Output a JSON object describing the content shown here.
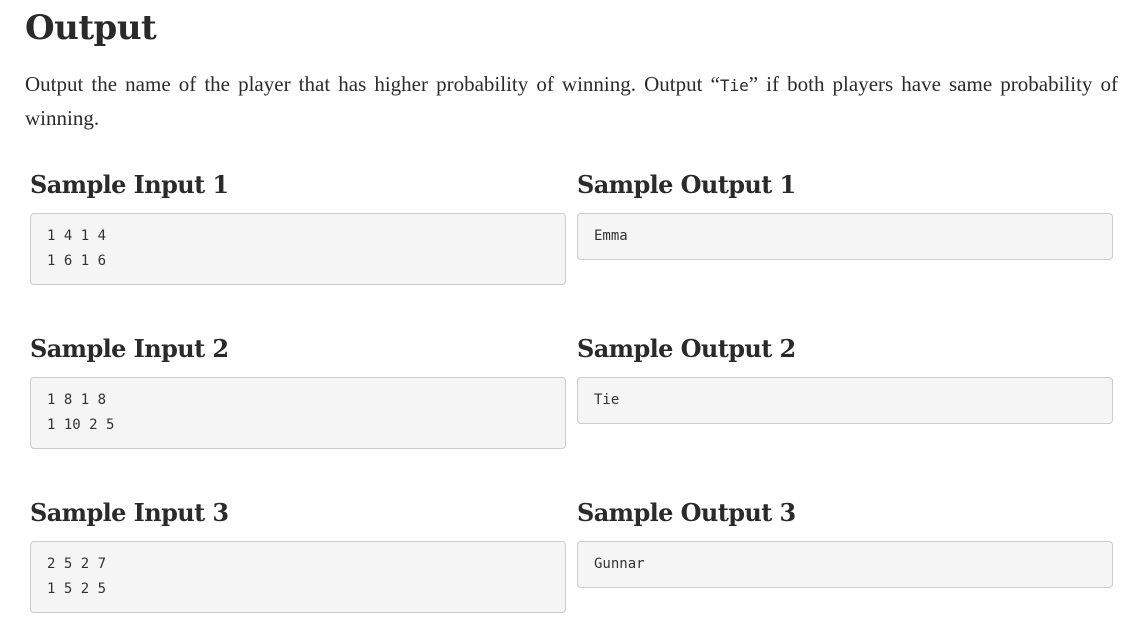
{
  "section": {
    "title": "Output",
    "description_before": "Output the name of the player that has higher probability of winning. Output “",
    "description_code": "Tie",
    "description_after": "” if both players have same probability of winning."
  },
  "samples": [
    {
      "input_heading": "Sample Input 1",
      "input_lines": [
        "1 4 1 4",
        "1 6 1 6"
      ],
      "output_heading": "Sample Output 1",
      "output_lines": [
        "Emma"
      ]
    },
    {
      "input_heading": "Sample Input 2",
      "input_lines": [
        "1 8 1 8",
        "1 10 2 5"
      ],
      "output_heading": "Sample Output 2",
      "output_lines": [
        "Tie"
      ]
    },
    {
      "input_heading": "Sample Input 3",
      "input_lines": [
        "2 5 2 7",
        "1 5 2 5"
      ],
      "output_heading": "Sample Output 3",
      "output_lines": [
        "Gunnar"
      ]
    }
  ]
}
